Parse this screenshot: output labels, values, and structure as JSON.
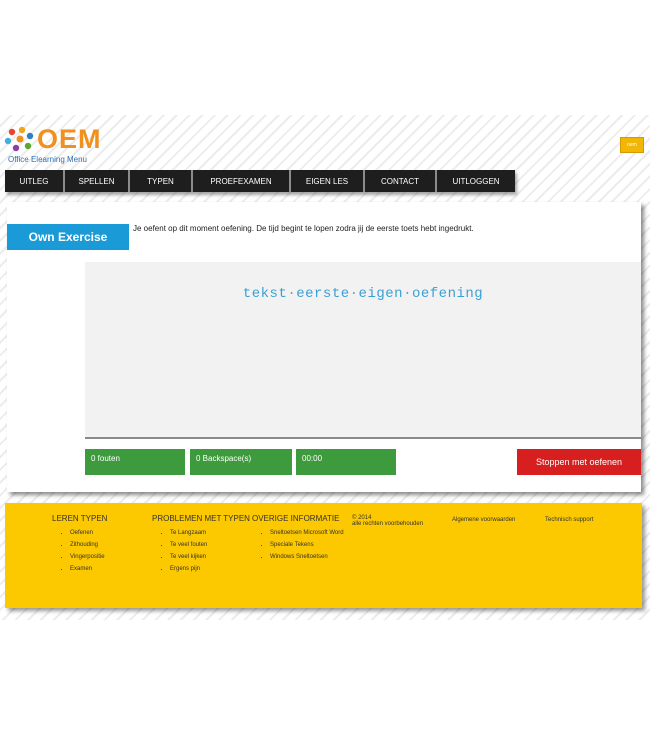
{
  "header": {
    "logo_text": "OEM",
    "logo_subtitle": "Office Elearning Menu",
    "lang_button": "oem"
  },
  "nav": {
    "items": [
      {
        "label": "UITLEG"
      },
      {
        "label": "SPELLEN"
      },
      {
        "label": "TYPEN"
      },
      {
        "label": "PROEFEXAMEN"
      },
      {
        "label": "EIGEN LES"
      },
      {
        "label": "CONTACT"
      },
      {
        "label": "UITLOGGEN"
      }
    ]
  },
  "exercise": {
    "badge": "Own Exercise",
    "instruction": "Je oefent op dit moment oefening. De tijd begint te lopen zodra jij de eerste toets hebt ingedrukt.",
    "words": [
      "tekst",
      "eerste",
      "eigen",
      "oefening"
    ],
    "separator": "·"
  },
  "stats": {
    "errors": "0 fouten",
    "backspaces": "0 Backspace(s)",
    "timer": "00:00"
  },
  "stop_button": "Stoppen met oefenen",
  "footer": {
    "col1": {
      "title": "LEREN TYPEN",
      "items": [
        "Oefenen",
        "Zithouding",
        "Vingerpositie",
        "Examen"
      ]
    },
    "col2": {
      "title": "PROBLEMEN MET TYPEN",
      "items": [
        "Te Langzaam",
        "Te veel fouten",
        "Te veel kijken",
        "Ergens pijn"
      ]
    },
    "col3": {
      "title": "OVERIGE INFORMATIE",
      "items": [
        "Sneltoetsen Microsoft Word",
        "Speciale Tekens",
        "Windows Sneltoetsen"
      ]
    },
    "copyright_line1": "© 2014",
    "copyright_line2": "alle rechten voorbehouden",
    "terms": "Algemene voorwaarden",
    "support": "Technisch support"
  },
  "colors": {
    "accent_blue": "#1a9ad6",
    "stat_green": "#3d9a3d",
    "stop_red": "#d81f1f",
    "footer_yellow": "#fcc800",
    "nav_dark": "#1e1e1e",
    "logo_orange": "#f0901e"
  }
}
